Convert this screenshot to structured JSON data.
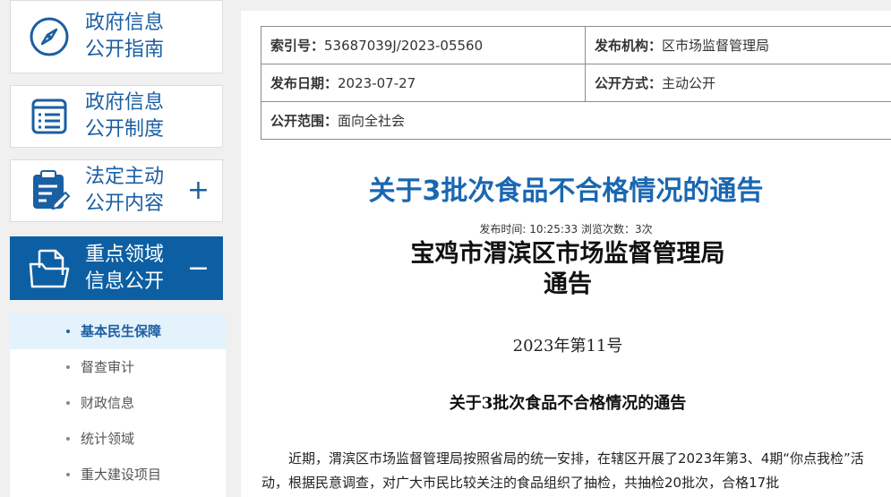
{
  "sidebar": {
    "nav": [
      {
        "line1": "政府信息",
        "line2": "公开指南",
        "icon": "compass-icon",
        "toggle": ""
      },
      {
        "line1": "政府信息",
        "line2": "公开制度",
        "icon": "list-document-icon",
        "toggle": ""
      },
      {
        "line1": "法定主动",
        "line2": "公开内容",
        "icon": "clipboard-edit-icon",
        "toggle": "+"
      },
      {
        "line1": "重点领域",
        "line2": "信息公开",
        "icon": "folder-document-icon",
        "toggle": "−"
      }
    ],
    "sub_items": [
      "基本民生保障",
      "督查审计",
      "财政信息",
      "统计领域",
      "重大建设项目"
    ],
    "active_sub": "基本民生保障",
    "colors": {
      "accent": "#0d5fa3",
      "active_bg": "#e4f2fb"
    }
  },
  "meta": {
    "index_label": "索引号：",
    "index_value": "53687039J/2023-05560",
    "org_label": "发布机构：",
    "org_value": "区市场监督管理局",
    "date_label": "发布日期：",
    "date_value": "2023-07-27",
    "mode_label": "公开方式：",
    "mode_value": "主动公开",
    "scope_label": "公开范围：",
    "scope_value": "面向全社会"
  },
  "article": {
    "title": "关于3批次食品不合格情况的通告",
    "info": "发布时间: 10:25:33 浏览次数：3次",
    "issuer_line1": "宝鸡市渭滨区市场监督管理局",
    "issuer_line2": "通告",
    "doc_number": "2023年第11号",
    "subtitle": "关于3批次食品不合格情况的通告",
    "body": "近期，渭滨区市场监督管理局按照省局的统一安排，在辖区开展了2023年第3、4期“你点我检”活动，根据民意调查，对广大市民比较关注的食品组织了抽检，共抽检20批次，合格17批"
  }
}
